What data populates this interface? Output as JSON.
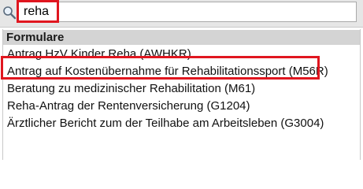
{
  "search": {
    "value": "reha"
  },
  "list": {
    "header": "Formulare",
    "items": [
      {
        "label": "Antrag HzV Kinder Reha (AWHKR)"
      },
      {
        "label": "Antrag auf Kostenübernahme für Rehabilitationssport (M56R)"
      },
      {
        "label": "Beratung zu medizinischer Rehabilitation (M61)"
      },
      {
        "label": "Reha-Antrag der Rentenversicherung (G1204)"
      },
      {
        "label": "Ärztlicher Bericht zum der Teilhabe am Arbeitsleben (G3004)"
      }
    ]
  },
  "icons": {
    "search": "magnifier-icon"
  },
  "colors": {
    "highlight": "#e0161f",
    "header_bg": "#d4d4d4",
    "toolbar_bg": "#e6e6e6"
  }
}
